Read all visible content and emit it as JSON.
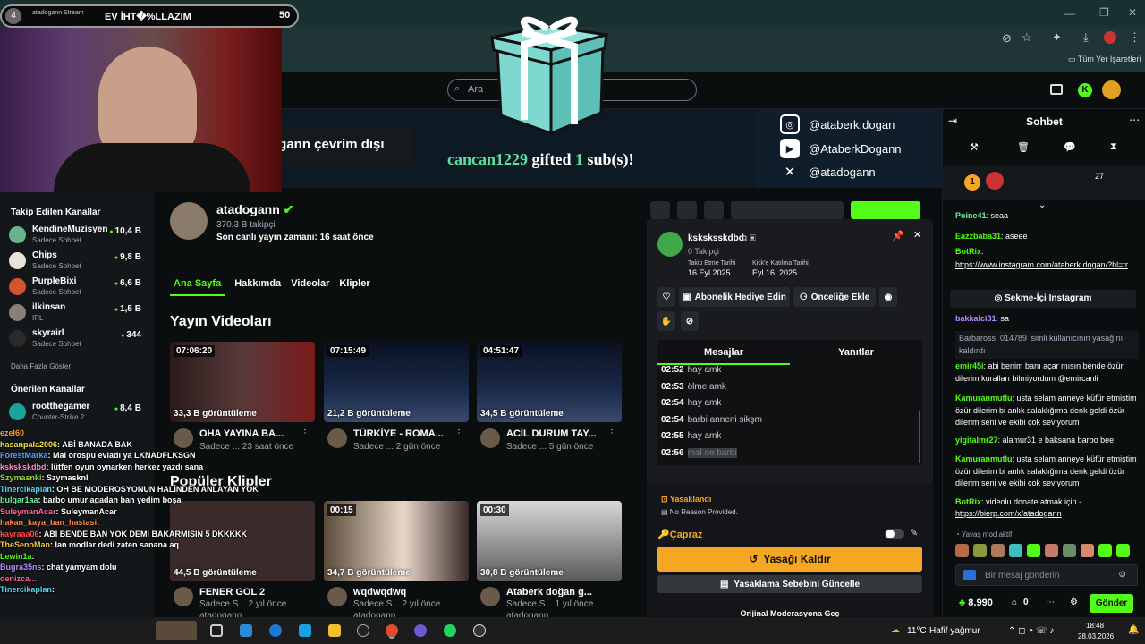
{
  "stream_bar": {
    "badge": "4",
    "title": "atadogann Stream",
    "overlay_text": "EV İHT�%LLAZIM",
    "count": "50"
  },
  "browser": {
    "bookmarks_label": "Tüm Yer İşaretleri"
  },
  "header": {
    "search_placeholder": "Ara"
  },
  "banner": {
    "offline_text": "ogann çevrim dışı",
    "socials": [
      {
        "icon": "instagram-icon",
        "handle": "@ataberk.dogan"
      },
      {
        "icon": "youtube-icon",
        "handle": "@AtaberkDogann"
      },
      {
        "icon": "x-icon",
        "handle": "@atadogann"
      }
    ]
  },
  "gift_alert": {
    "user": "cancan1229",
    "mid": "gifted",
    "num": "1",
    "tail": "sub(s)!"
  },
  "sidebar": {
    "followed_title": "Takip Edilen Kanallar",
    "followed": [
      {
        "name": "KendineMuzisyen",
        "sub": "Sadece Sohbet",
        "count": "10,4 B",
        "color": "#6ab28a"
      },
      {
        "name": "Chips",
        "sub": "Sadece Sohbet",
        "count": "9,8 B",
        "color": "#e8e2d8"
      },
      {
        "name": "PurpleBixi",
        "sub": "Sadece Sohbet",
        "count": "6,6 B",
        "color": "#d0542c"
      },
      {
        "name": "ilkinsan",
        "sub": "IRL",
        "count": "1,5 B",
        "color": "#8a7f7a"
      },
      {
        "name": "skyrairl",
        "sub": "Sadece Sohbet",
        "count": "344",
        "color": "#2a2a2a"
      }
    ],
    "show_more": "Daha Fazla Göster",
    "suggested_title": "Önerilen Kanallar",
    "suggested": [
      {
        "name": "rootthegamer",
        "sub": "Counter-Strike 2",
        "count": "8,4 B",
        "color": "#1aa29b"
      }
    ]
  },
  "channel": {
    "name": "atadogann",
    "followers": "370,3 B takipçi",
    "last_live": "Son canlı yayın zamanı: 16 saat önce",
    "tabs": [
      "Ana Sayfa",
      "Hakkımda",
      "Videolar",
      "Klipler"
    ],
    "videos_title": "Yayın Videoları",
    "videos": [
      {
        "duration": "07:06:20",
        "views": "33,3 B görüntüleme",
        "title": "OHA YAYINA BA...",
        "meta": "Sadece ... 23 saat önce"
      },
      {
        "duration": "07:15:49",
        "views": "21,2 B görüntüleme",
        "title": "TÜRKİYE - ROMA...",
        "meta": "Sadece ... 2 gün önce"
      },
      {
        "duration": "04:51:47",
        "views": "34,5 B görüntüleme",
        "title": "ACİL DURUM TAY...",
        "meta": "Sadece ... 5 gün önce"
      }
    ],
    "clips_title": "Popüler Klipler",
    "clips": [
      {
        "duration": "",
        "views": "44,5 B görüntüleme",
        "title": "FENER GOL 2",
        "meta": "Sadece S... 2 yıl önce",
        "author": "atadogann"
      },
      {
        "duration": "00:15",
        "views": "34,7 B görüntüleme",
        "title": "wqdwqdwq",
        "meta": "Sadece S... 2 yıl önce",
        "author": "atadogann"
      },
      {
        "duration": "00:30",
        "views": "30,8 B görüntüleme",
        "title": "Ataberk doğan g...",
        "meta": "Sadece S... 1 yıl önce",
        "author": "atadogann"
      }
    ]
  },
  "overlay_chat": [
    {
      "user": "ezel60",
      "text": "",
      "color": "#e8a33c"
    },
    {
      "user": "hasanpala2006",
      "text": ": ABİ BANADA BAK",
      "color": "#f0e64a"
    },
    {
      "user": "ForestMarka",
      "text": ": Mal orospu evladı ya LKNADFLKSGN",
      "color": "#5da0ff"
    },
    {
      "user": "kskskskdbd",
      "text": ": lütfen oyun oynarken herkez yazdı sana",
      "color": "#ff8ad6"
    },
    {
      "user": "Szymasnki",
      "text": ": Szymasknl",
      "color": "#9bd24a"
    },
    {
      "user": "Tinercikaplan",
      "text": ": OH BE MODEROSYONUN HALİNDEN ANLAYAN YOK",
      "color": "#58d6f5"
    },
    {
      "user": "bulgar1aa",
      "text": ": barbo umur agadan ban yedim boşa",
      "color": "#6ef2a0"
    },
    {
      "user": "SuleymanAcar",
      "text": ": SuleymanAcar",
      "color": "#ff6b9a"
    },
    {
      "user": "hakan_kaya_ban_hastasi",
      "text": ":",
      "color": "#ff8844"
    },
    {
      "user": "kayraaa06",
      "text": ": ABİ BENDE BAN YOK DEMİ BAKARMISIN 5 DKKKKK",
      "color": "#ff4d4d"
    },
    {
      "user": "TheSenoMan",
      "text": ": lan modlar dedi zaten sanana aq",
      "color": "#f2c84b"
    },
    {
      "user": "Lewin1a",
      "text": ":",
      "color": "#53fc18"
    },
    {
      "user": "Bugra35ns",
      "text": ": chat yamyam dolu",
      "color": "#b58cff"
    },
    {
      "user": "denizca...",
      "text": "",
      "color": "#ff5fa2"
    },
    {
      "user": "Tinercikaplan",
      "text": ":",
      "color": "#58d6f5"
    }
  ],
  "mod_card": {
    "username": "ksksksskdbd",
    "followers": "0 Takipçi",
    "follow_date_label": "Takip Etme Tarihi",
    "follow_date": "16 Eyl 2025",
    "join_label": "Kick'e Katılma Tarihi",
    "join_date": "Eyl 16, 2025",
    "btn_gift": "Abonelik Hediye Edin",
    "btn_priority": "Önceliğe Ekle",
    "tab_messages": "Mesajlar",
    "tab_replies": "Yanıtlar",
    "log": [
      {
        "time": "02:52",
        "text": "hay amk"
      },
      {
        "time": "02:53",
        "text": "ölme amk"
      },
      {
        "time": "02:54",
        "text": "hay amk"
      },
      {
        "time": "02:54",
        "text": "barbi anneni sikşm"
      },
      {
        "time": "02:55",
        "text": "hay amk"
      },
      {
        "time": "02:56",
        "text": "mal oe barbi"
      }
    ],
    "banned_title": "Yasaklandı",
    "banned_reason": "No Reason Provided.",
    "cross": "Çapraz",
    "unban": "Yasağı Kaldır",
    "update_reason": "Yasaklama Sebebini Güncelle",
    "footer": "Orijinal Moderasyona Geç"
  },
  "chat": {
    "title": "Sohbet",
    "top_badge": "27",
    "messages": [
      {
        "user": "Poine41",
        "text": ": seaa",
        "color": "#6ef2a0"
      },
      {
        "user": "Eazzbaba31",
        "text": ": aseee",
        "color": "#53fc18"
      },
      {
        "user": "BotRix",
        "text": ":",
        "color": "#53fc18"
      },
      {
        "user": "",
        "text": "https://www.instagram.com/ataberk.dogan/?hl=tr",
        "color": "#fff"
      },
      {
        "user": "bakkalci31",
        "text": ": sa",
        "color": "#b58cff"
      },
      {
        "user": "",
        "text": "Barbaross, 014789 isimli kullanıcının yasağını kaldırdı",
        "color": "#aab"
      },
      {
        "user": "emir45i",
        "text": ": abi benim banı açar mısın bende özür dilerim kuralları bilmiyordum @emircanli",
        "color": "#53fc18"
      },
      {
        "user": "Kamuranmutlu",
        "text": ": usta selam anneye küfür etmiştim özür dilerim bi anlık salaklığıma denk geldi özür dilerim seni ve ekibi çok seviyorum",
        "color": "#53fc18"
      },
      {
        "user": "yigitalmr27",
        "text": ": alamur31 e baksana barbo bee",
        "color": "#53fc18"
      },
      {
        "user": "Kamuranmutlu",
        "text": ": usta selam anneye küfür etmiştim özür dilerim bi anlık salaklığıma denk geldi özür dilerim seni ve ekibi çok seviyorum",
        "color": "#53fc18"
      },
      {
        "user": "BotRix",
        "text": ": videolu donate atmak için -",
        "color": "#53fc18"
      },
      {
        "user": "",
        "text": "https://bierp.com/x/atadogann",
        "color": "#fff"
      }
    ],
    "pinned_button": "Sekme-İçi Instagram",
    "slow_mode": "Yavaş mod aktif",
    "input_placeholder": "Bir mesaj gönderin",
    "points": "8.990",
    "zero": "0",
    "send": "Gönder"
  },
  "taskbar": {
    "weather": "11°C",
    "weather_desc": "Hafif yağmur",
    "time": "18:48",
    "date": "28.03.2026"
  }
}
